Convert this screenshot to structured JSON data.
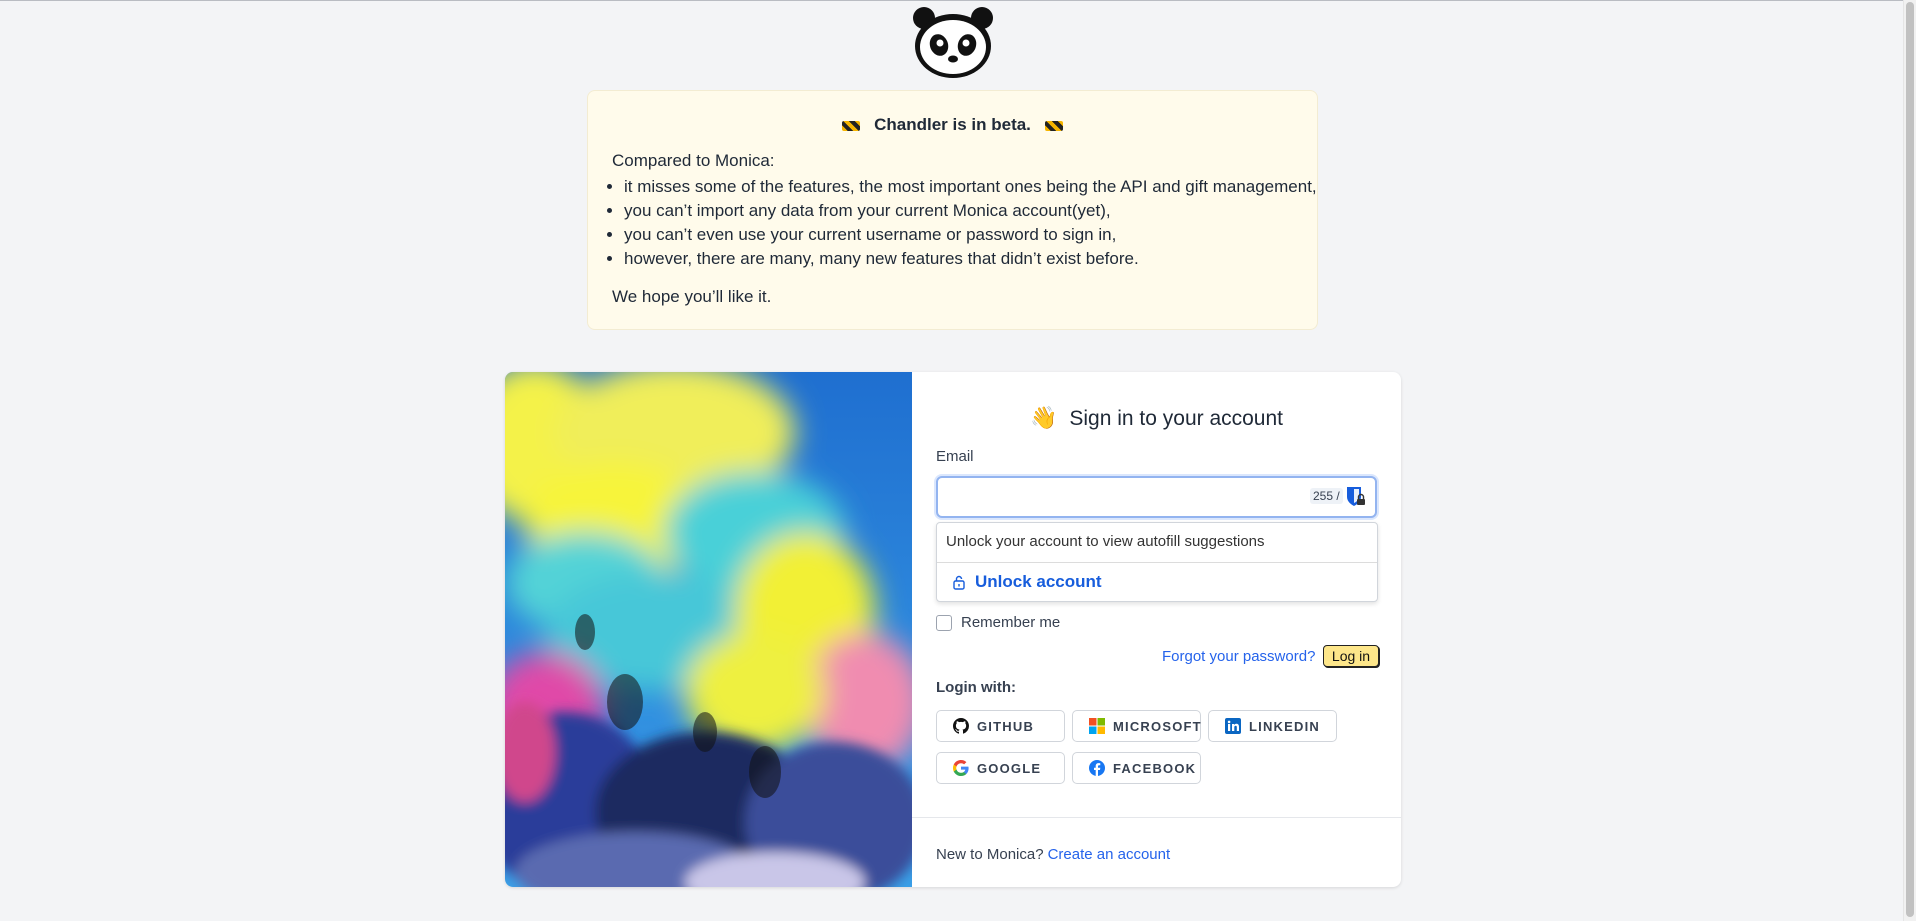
{
  "beta": {
    "title": "Chandler is in beta.",
    "intro": "Compared to Monica:",
    "points": [
      "it misses some of the features, the most important ones being the API and gift management,",
      "you can’t import any data from your current Monica account(yet),",
      "you can’t even use your current username or password to sign in,",
      "however, there are many, many new features that didn’t exist before."
    ],
    "outro": "We hope you’ll like it."
  },
  "signin": {
    "title": "Sign in to your account",
    "email_label": "Email",
    "email_value": "",
    "counter": "255 /",
    "remember_label": "Remember me",
    "forgot_label": "Forgot your password?",
    "login_label": "Log in",
    "login_with_label": "Login with:",
    "providers": {
      "github": "GITHUB",
      "microsoft": "MICROSOFT",
      "linkedin": "LINKEDIN",
      "google": "GOOGLE",
      "facebook": "FACEBOOK"
    },
    "new_text": "New to Monica?",
    "create_label": "Create an account"
  },
  "autofill": {
    "message": "Unlock your account to view autofill suggestions",
    "unlock_label": "Unlock account"
  },
  "icons": [
    "panda-logo-icon",
    "wave-hand-icon",
    "construction-sign-icon",
    "bitwarden-icon",
    "lock-icon",
    "github-icon",
    "microsoft-icon",
    "linkedin-icon",
    "google-icon",
    "facebook-icon"
  ],
  "colors": {
    "beta_bg": "#fffbeb",
    "login_button": "#fde68a",
    "link": "#2563eb",
    "bitwarden_blue": "#175ddc"
  }
}
